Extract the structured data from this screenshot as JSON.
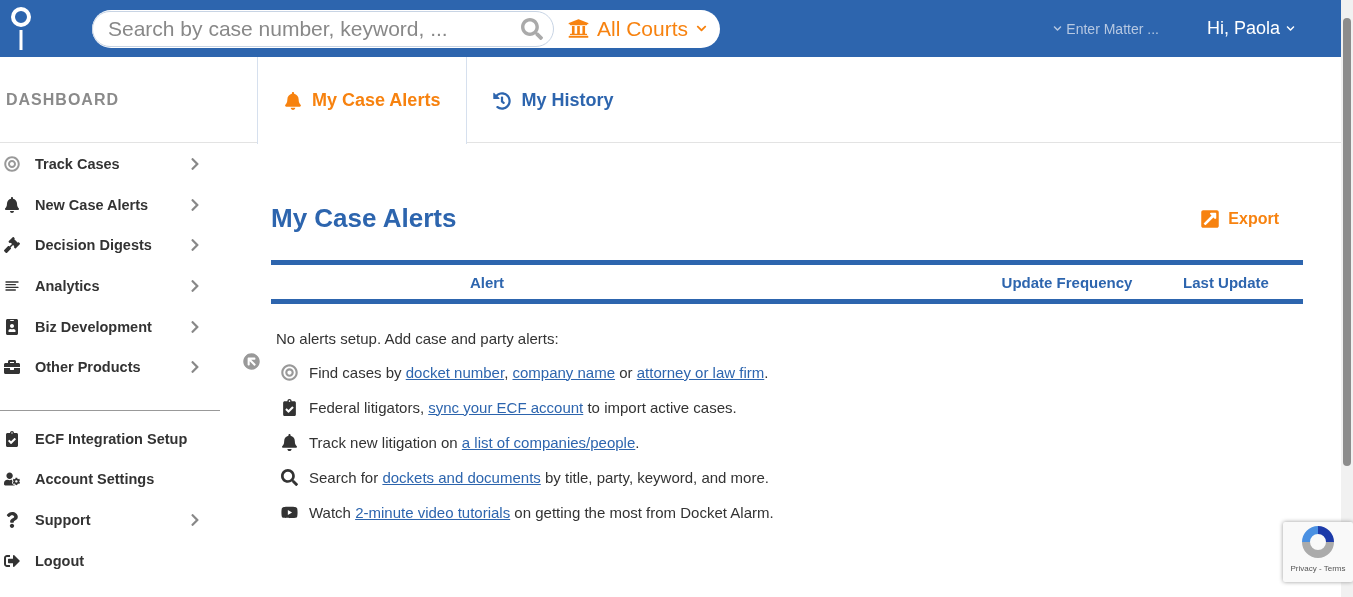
{
  "header": {
    "search": {
      "placeholder": "Search by case number, keyword, ..."
    },
    "court_filter": "All Courts",
    "matter": "Enter Matter ...",
    "user": "Hi, Paola"
  },
  "sidebar": {
    "title": "DASHBOARD",
    "items": [
      {
        "label": "Track Cases",
        "chevron": true
      },
      {
        "label": "New Case Alerts",
        "chevron": true
      },
      {
        "label": "Decision Digests",
        "chevron": true
      },
      {
        "label": "Analytics",
        "chevron": true
      },
      {
        "label": "Biz Development",
        "chevron": true
      },
      {
        "label": "Other Products",
        "chevron": true
      }
    ],
    "bottom_items": [
      {
        "label": "ECF Integration Setup",
        "chevron": false
      },
      {
        "label": "Account Settings",
        "chevron": false
      },
      {
        "label": "Support",
        "chevron": true
      },
      {
        "label": "Logout",
        "chevron": false
      }
    ]
  },
  "tabs": [
    {
      "label": "My Case Alerts",
      "selected": true
    },
    {
      "label": "My History",
      "selected": false
    }
  ],
  "main": {
    "title": "My Case Alerts",
    "export": "Export",
    "columns": [
      "Alert",
      "Update Frequency",
      "Last Update"
    ],
    "intro": "No alerts setup. Add case and party alerts:",
    "suggestions": [
      {
        "parts": [
          {
            "kind": "text",
            "text": "Find cases by "
          },
          {
            "kind": "link",
            "text": "docket number"
          },
          {
            "kind": "text",
            "text": ", "
          },
          {
            "kind": "link",
            "text": "company name"
          },
          {
            "kind": "text",
            "text": " or "
          },
          {
            "kind": "link",
            "text": "attorney or law firm"
          },
          {
            "kind": "text",
            "text": "."
          }
        ]
      },
      {
        "parts": [
          {
            "kind": "text",
            "text": "Federal litigators, "
          },
          {
            "kind": "link",
            "text": "sync your ECF account"
          },
          {
            "kind": "text",
            "text": " to import active cases."
          }
        ]
      },
      {
        "parts": [
          {
            "kind": "text",
            "text": "Track new litigation on "
          },
          {
            "kind": "link",
            "text": "a list of companies/people"
          },
          {
            "kind": "text",
            "text": "."
          }
        ]
      },
      {
        "parts": [
          {
            "kind": "text",
            "text": "Search for "
          },
          {
            "kind": "link",
            "text": "dockets and documents"
          },
          {
            "kind": "text",
            "text": " by title, party, keyword, and more."
          }
        ]
      },
      {
        "parts": [
          {
            "kind": "text",
            "text": "Watch "
          },
          {
            "kind": "link",
            "text": "2-minute video tutorials"
          },
          {
            "kind": "text",
            "text": " on getting the most from Docket Alarm."
          }
        ]
      }
    ]
  },
  "recaptcha": {
    "text": "Privacy - Terms"
  }
}
